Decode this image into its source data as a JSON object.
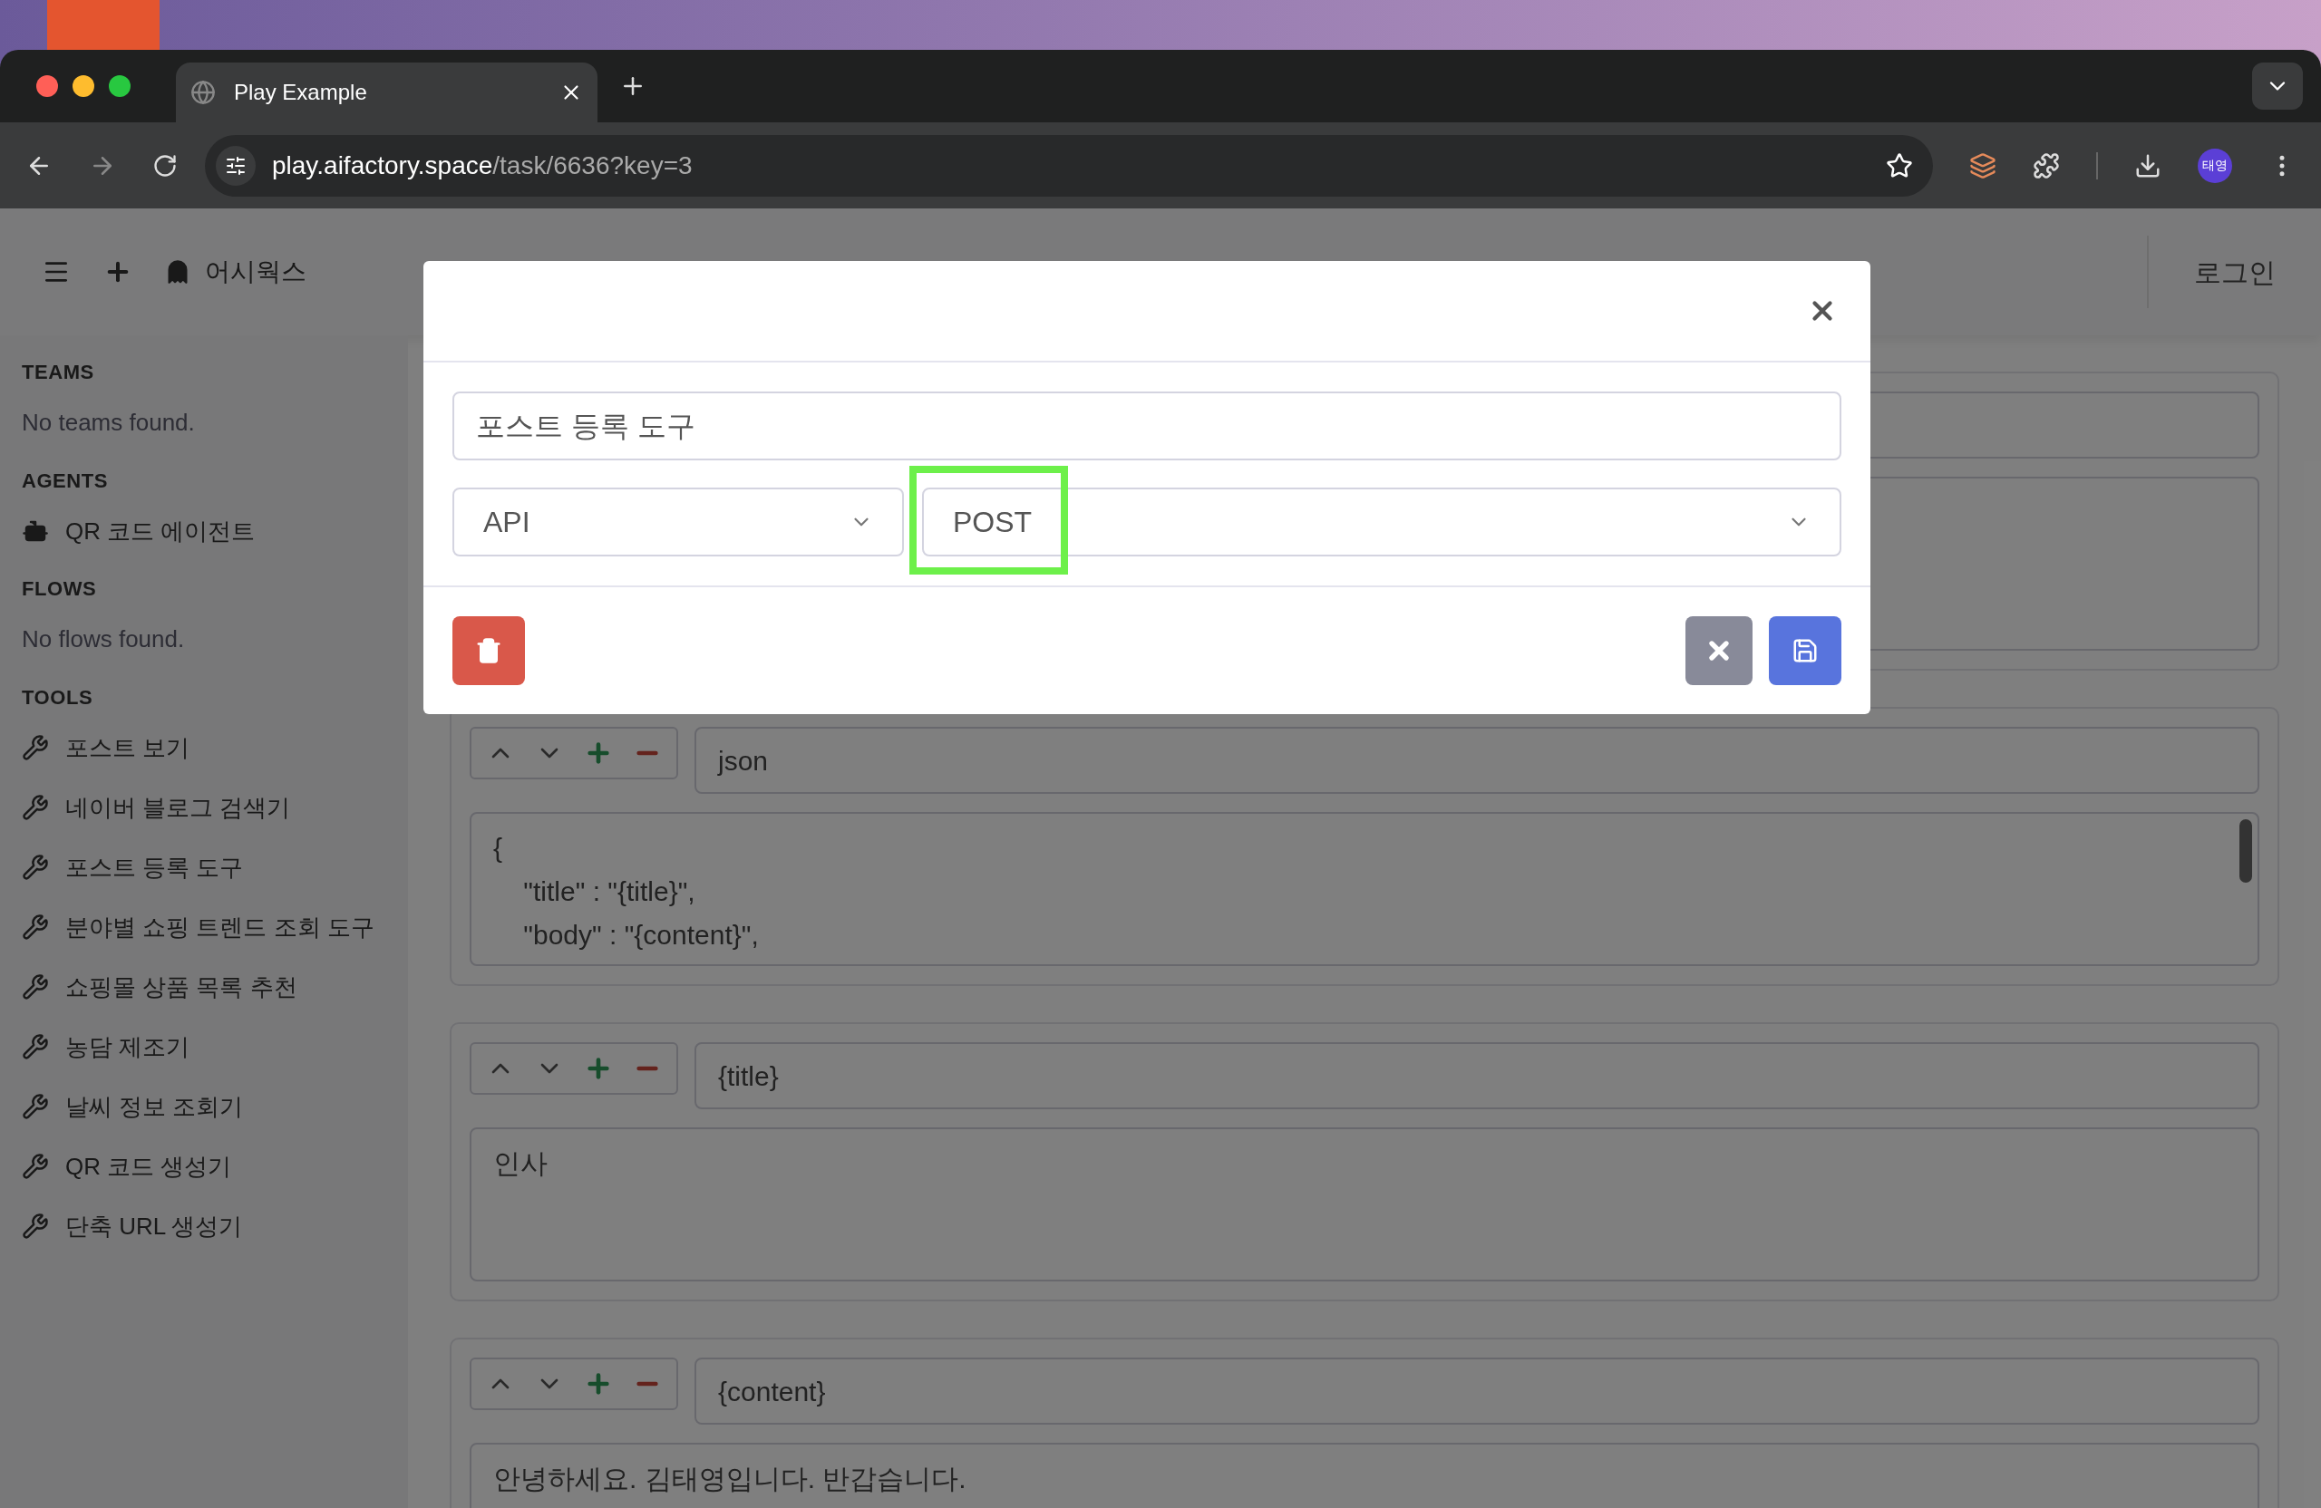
{
  "browser": {
    "tab_title": "Play Example",
    "url_host": "play.aifactory.space",
    "url_path": "/task/6636?key=3",
    "profile": "태영"
  },
  "header": {
    "brand": "어시웍스",
    "login": "로그인"
  },
  "sidebar": {
    "sections": [
      {
        "heading": "TEAMS",
        "items": [
          {
            "kind": "empty",
            "label": "No teams found."
          }
        ]
      },
      {
        "heading": "AGENTS",
        "items": [
          {
            "kind": "agent",
            "label": "QR 코드 에이전트"
          }
        ]
      },
      {
        "heading": "FLOWS",
        "items": [
          {
            "kind": "empty",
            "label": "No flows found."
          }
        ]
      },
      {
        "heading": "TOOLS",
        "items": [
          {
            "kind": "tool",
            "label": "포스트 보기"
          },
          {
            "kind": "tool",
            "label": "네이버 블로그 검색기"
          },
          {
            "kind": "tool",
            "label": "포스트 등록 도구"
          },
          {
            "kind": "tool",
            "label": "분야별 쇼핑 트렌드 조회 도구"
          },
          {
            "kind": "tool",
            "label": "쇼핑몰 상품 목록 추천"
          },
          {
            "kind": "tool",
            "label": "농담 제조기"
          },
          {
            "kind": "tool",
            "label": "날씨 정보 조회기"
          },
          {
            "kind": "tool",
            "label": "QR 코드 생성기"
          },
          {
            "kind": "tool",
            "label": "단축 URL 생성기"
          }
        ]
      }
    ]
  },
  "params": [
    {
      "name": "json",
      "body_lines": [
        "{",
        "    \"title\" : \"{title}\",",
        "    \"body\" : \"{content}\","
      ],
      "scroll": true
    },
    {
      "name": "{title}",
      "body_lines": [
        "인사"
      ],
      "scroll": false
    },
    {
      "name": "{content}",
      "body_lines": [
        "안녕하세요. 김태영입니다. 반갑습니다."
      ],
      "scroll": false
    }
  ],
  "modal": {
    "title_value": "포스트 등록 도구",
    "type_value": "API",
    "method_value": "POST",
    "method_highlighted": true
  }
}
